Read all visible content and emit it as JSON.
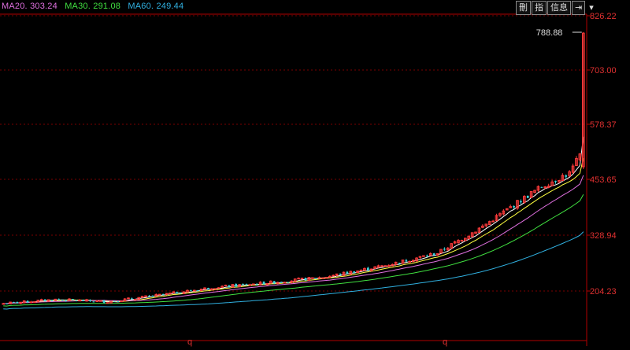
{
  "legend": {
    "ma20_label": "MA20.",
    "ma20_value": "303.24",
    "ma30_label": "MA30.",
    "ma30_value": "291.08",
    "ma60_label": "MA60.",
    "ma60_value": "249.44"
  },
  "toolbar": {
    "btn1": "刪",
    "btn2": "指",
    "btn3": "信息",
    "btn4": "⇥",
    "btn5": "▾"
  },
  "colors": {
    "up": "#ff3b3b",
    "down": "#3ad8e0",
    "ma5": "#ffffff",
    "ma10": "#ffff40",
    "ma20": "#e070e0",
    "ma30": "#40e040",
    "ma60": "#30b0e0",
    "grid": "#7a0000",
    "axis": "#b00000"
  },
  "chart_data": {
    "type": "candlestick",
    "y_ticks": [
      "826.22",
      "703.00",
      "578.37",
      "453.65",
      "328.94",
      "204.23"
    ],
    "ylim": [
      157,
      830
    ],
    "max_label": "788.88",
    "month_marks": [
      "q",
      "q"
    ],
    "candle_count": 168,
    "series": [
      {
        "name": "MA20",
        "last": 303.24
      },
      {
        "name": "MA30",
        "last": 291.08
      },
      {
        "name": "MA60",
        "last": 249.44
      }
    ]
  }
}
